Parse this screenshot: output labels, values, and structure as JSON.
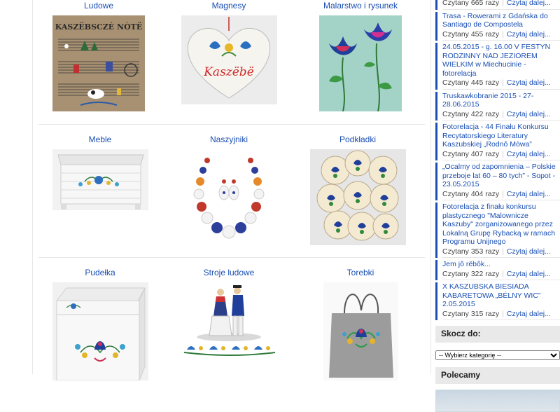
{
  "gallery": [
    {
      "label": "Ludowe"
    },
    {
      "label": "Magnesy"
    },
    {
      "label": "Malarstwo i rysunek"
    },
    {
      "label": "Meble"
    },
    {
      "label": "Naszyjniki"
    },
    {
      "label": "Podkładki"
    },
    {
      "label": "Pudełka"
    },
    {
      "label": "Stroje ludowe"
    },
    {
      "label": "Torebki"
    }
  ],
  "images": {
    "ludowe_text": "KASZËBSCZÉ NÒTË",
    "magnes_text": "Kaszëbë"
  },
  "sidebar": {
    "top_meta": {
      "reads": "Czytany 665 razy",
      "more": "Czytaj dalej..."
    },
    "articles": [
      {
        "title": "Trasa - Rowerami z Gdańska do Santiago de Compostela",
        "reads": "Czytany 455 razy",
        "more": "Czytaj dalej..."
      },
      {
        "title": "24.05.2015 - g. 16.00 V FESTYN RODZINNY NAD JEZIOREM WIELKIM w Miechucinie - fotorelacja",
        "reads": "Czytany 445 razy",
        "more": "Czytaj dalej..."
      },
      {
        "title": "Truskawkobranie 2015 - 27-28.06.2015",
        "reads": "Czytany 422 razy",
        "more": "Czytaj dalej..."
      },
      {
        "title": "Fotorelacja - 44 Finału Konkursu Recytatorskiego Literatury Kaszubskiej „Rodnô Mòwa”",
        "reads": "Czytany 407 razy",
        "more": "Czytaj dalej..."
      },
      {
        "title": "„Ocalmy od zapomnienia – Polskie przeboje lat 60 – 80 tych” - Sopot - 23.05.2015",
        "reads": "Czytany 404 razy",
        "more": "Czytaj dalej..."
      },
      {
        "title": "Fotorelacja z finału konkursu plastycznego \"Malownicze Kaszuby\" zorganizowanego przez Lokalną Grupę Rybacką w ramach Programu Unijnego",
        "reads": "Czytany 353 razy",
        "more": "Czytaj dalej..."
      },
      {
        "title": "Jem jô rëbôk...",
        "reads": "Czytany 322 razy",
        "more": "Czytaj dalej..."
      },
      {
        "title": "X KASZUBSKA BIESIADA KABARETOWA „BÉLNY WIC” 2.05.2015",
        "reads": "Czytany 315 razy",
        "more": "Czytaj dalej..."
      }
    ],
    "jump": {
      "heading": "Skocz do:",
      "selected": "-- Wybierz kategorię --"
    },
    "recommended": {
      "heading": "Polecamy"
    }
  },
  "colors": {
    "link": "#1a4fb3",
    "border": "#e6e6e6",
    "box_header": "#e9e9e9"
  }
}
